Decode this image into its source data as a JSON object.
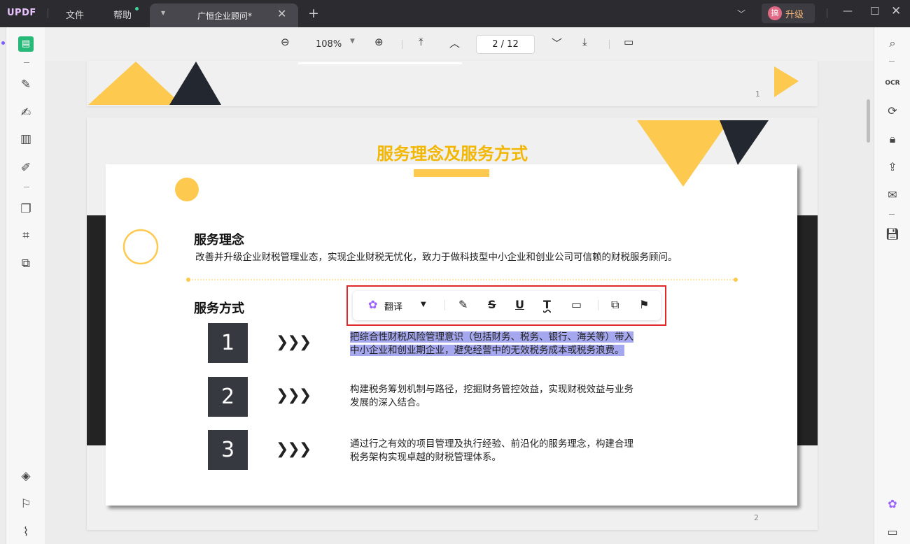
{
  "app": {
    "logo": "UPDF",
    "menu": [
      "文件",
      "帮助"
    ],
    "tab_title": "广恒企业顾问*",
    "upgrade_label": "升级",
    "avatar_text": "搞"
  },
  "toolbar": {
    "zoom": "108%",
    "page_indicator": "2  /  12"
  },
  "page1": {
    "page_number": "1"
  },
  "page2": {
    "title": "服务理念及服务方式",
    "section1_heading": "服务理念",
    "section1_body": "改善并升级企业财税管理业态，实现企业财税无忧化，致力于做科技型中小企业和创业公司可信赖的财税服务顾问。",
    "section2_heading": "服务方式",
    "items": [
      {
        "num": "1",
        "text_line1": "把综合性财税风险管理意识（包括财务、税务、银行、海关等）带入",
        "text_line2": "中小企业和创业期企业，避免经营中的无效税务成本或税务浪费。"
      },
      {
        "num": "2",
        "text_line1": "构建税务筹划机制与路径，挖掘财务管控效益，实现财税效益与业务",
        "text_line2": "发展的深入结合。"
      },
      {
        "num": "3",
        "text_line1": "通过行之有效的项目管理及执行经验、前沿化的服务理念，构建合理",
        "text_line2": "税务架构实现卓越的财税管理体系。"
      }
    ],
    "chevrons": "❯❯❯",
    "page_number": "2"
  },
  "popup": {
    "translate_label": "翻译"
  },
  "colors": {
    "accent_yellow": "#fdc94f",
    "title_yellow": "#f2b705",
    "dark": "#232323",
    "highlight": "#a6a8ef",
    "red_box": "#e02a2a",
    "brand_green": "#27b978"
  }
}
